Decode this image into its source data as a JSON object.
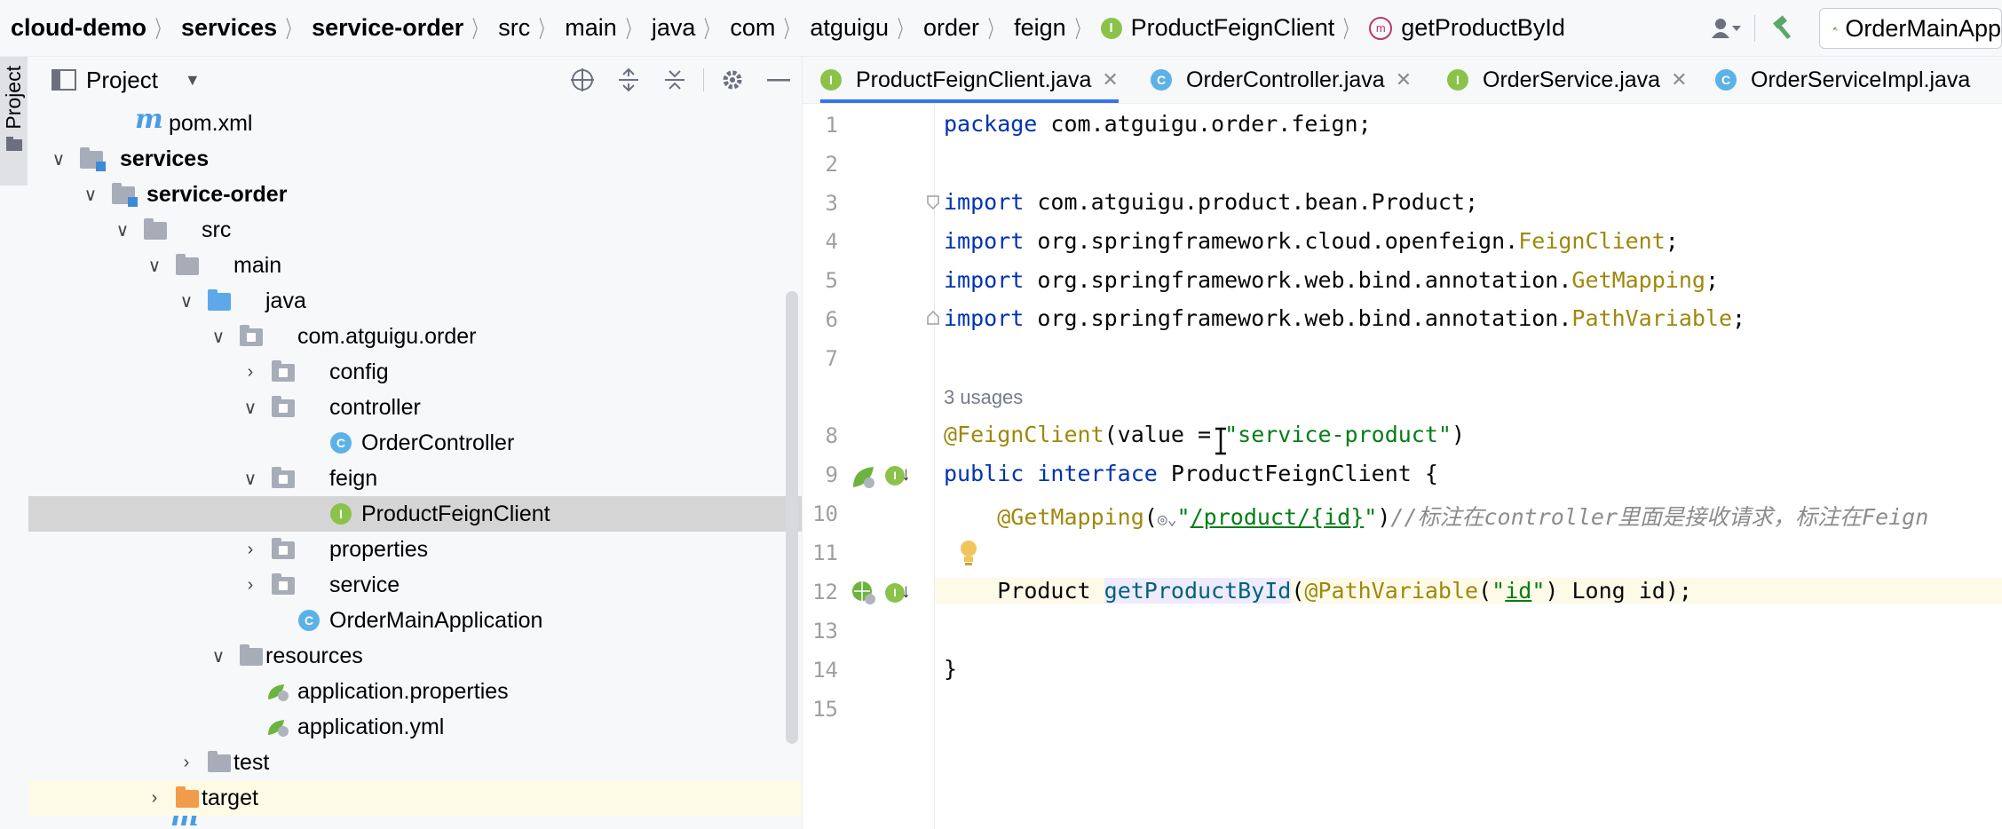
{
  "breadcrumb": [
    "cloud-demo",
    "services",
    "service-order",
    "src",
    "main",
    "java",
    "com",
    "atguigu",
    "order",
    "feign",
    "ProductFeignClient",
    "getProductById"
  ],
  "run_config": "OrderMainApp",
  "project_panel": {
    "title": "Project",
    "stripe_label": "Project"
  },
  "tree": [
    {
      "label": "pom.xml"
    },
    {
      "label": "services"
    },
    {
      "label": "service-order"
    },
    {
      "label": "src"
    },
    {
      "label": "main"
    },
    {
      "label": "java"
    },
    {
      "label": "com.atguigu.order"
    },
    {
      "label": "config"
    },
    {
      "label": "controller"
    },
    {
      "label": "OrderController"
    },
    {
      "label": "feign"
    },
    {
      "label": "ProductFeignClient"
    },
    {
      "label": "properties"
    },
    {
      "label": "service"
    },
    {
      "label": "OrderMainApplication"
    },
    {
      "label": "resources"
    },
    {
      "label": "application.properties"
    },
    {
      "label": "application.yml"
    },
    {
      "label": "test"
    },
    {
      "label": "target"
    }
  ],
  "tabs": [
    {
      "label": "ProductFeignClient.java",
      "type": "I"
    },
    {
      "label": "OrderController.java",
      "type": "C"
    },
    {
      "label": "OrderService.java",
      "type": "I"
    },
    {
      "label": "OrderServiceImpl.java",
      "type": "C"
    }
  ],
  "code": {
    "line_numbers": [
      "1",
      "2",
      "3",
      "4",
      "5",
      "6",
      "7",
      "8",
      "9",
      "10",
      "11",
      "12",
      "13",
      "14",
      "15"
    ],
    "usages_hint": "3 usages",
    "l1": {
      "kw": "package",
      "rest": " com.atguigu.order.feign;"
    },
    "l3": {
      "kw": "import",
      "rest": " com.atguigu.product.bean.Product;"
    },
    "l4": {
      "kw": "import",
      "rest": " org.springframework.cloud.openfeign.",
      "ann": "FeignClient",
      ";": ";"
    },
    "l5": {
      "kw": "import",
      "rest": " org.springframework.web.bind.annotation.",
      "ann": "GetMapping",
      ";": ";"
    },
    "l6": {
      "kw": "import",
      "rest": " org.springframework.web.bind.annotation.",
      "ann": "PathVariable",
      ";": ";"
    },
    "l8": {
      "ann": "@FeignClient",
      "a": "(value ",
      "eq": "= ",
      "str": "\"service-product\"",
      "b": ")"
    },
    "l9": {
      "kw1": "public",
      "kw2": "interface",
      "rest": " ProductFeignClient {"
    },
    "l10": {
      "ann": "@GetMapping",
      "a": "(",
      "str_q1": "\"",
      "str_path": "/product/{id}",
      "str_q2": "\"",
      "b": ")",
      "cmt": "//标注在controller里面是接收请求，标注在Feign"
    },
    "l12": {
      "type": "Product ",
      "fn": "getProductById",
      "a": "(",
      "ann": "@PathVariable",
      "b": "(",
      "str_q1": "\"",
      "str_id": "id",
      "str_q2": "\"",
      "c": ") Long id);"
    },
    "l14": "}"
  },
  "colors": {
    "keyword": "#0033b3",
    "annotation": "#9e880d",
    "string": "#067d17",
    "comment": "#8c8c8c",
    "accent": "#3574f0"
  }
}
